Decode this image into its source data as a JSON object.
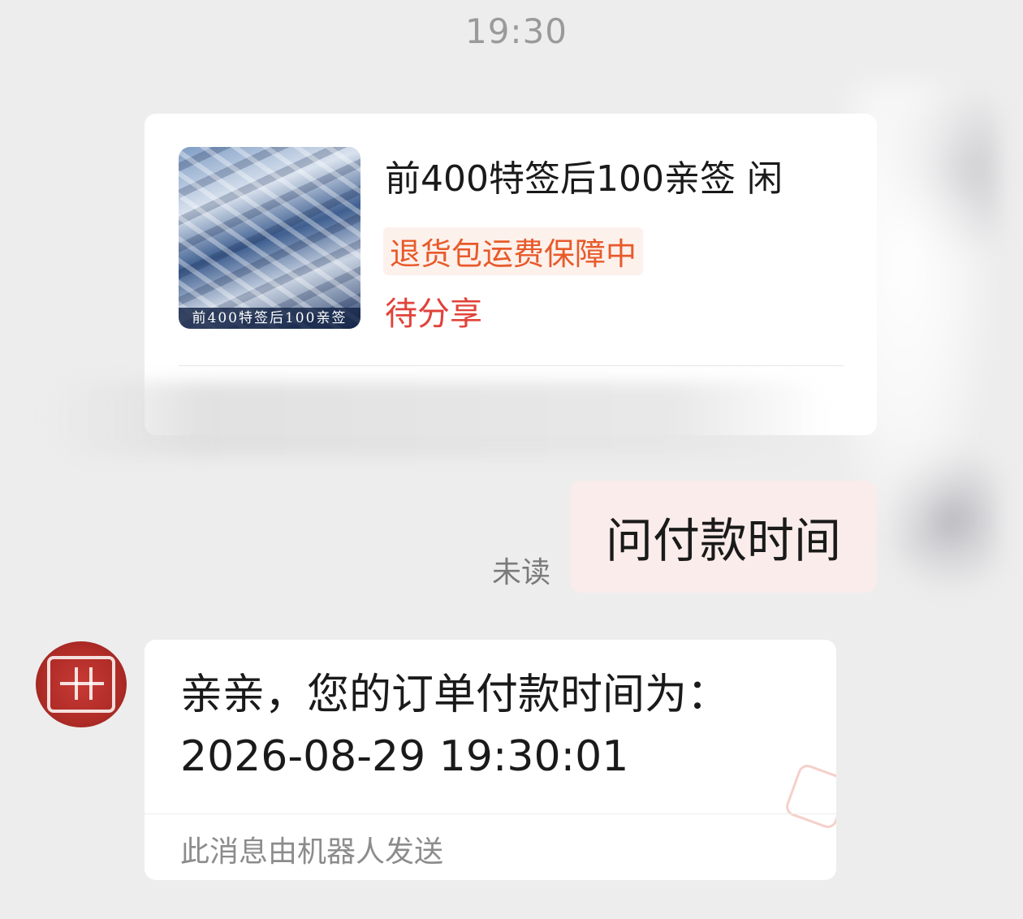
{
  "timestamp": "19:30",
  "product_card": {
    "image_caption": "前400特签后100亲签",
    "title": "前400特签后100亲签 闲",
    "guarantee_tag": "退货包运费保障中",
    "status": "待分享"
  },
  "outgoing_message": {
    "text": "问付款时间",
    "read_status": "未读"
  },
  "incoming_message": {
    "line1": "亲亲，您的订单付款时间为：",
    "line2": "2026-08-29 19:30:01",
    "footer": "此消息由机器人发送"
  },
  "colors": {
    "background": "#ededed",
    "outgoing_bubble": "#f9ecea",
    "guarantee_text": "#e85a2a",
    "status_text": "#e0433a",
    "seal": "#b02c27"
  },
  "icons": {
    "avatar": "red-seal-avatar-icon"
  }
}
